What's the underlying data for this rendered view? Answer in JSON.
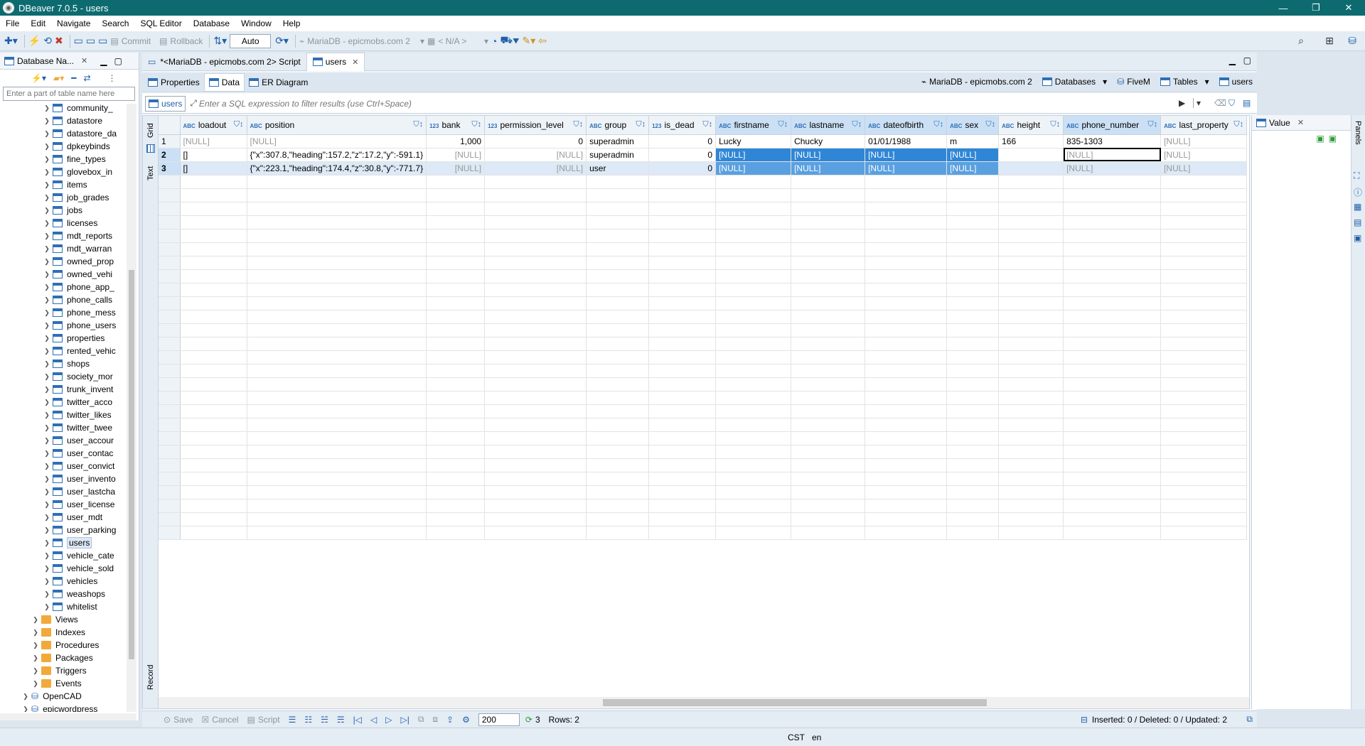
{
  "window": {
    "title": "DBeaver 7.0.5 - users"
  },
  "menu": [
    "File",
    "Edit",
    "Navigate",
    "Search",
    "SQL Editor",
    "Database",
    "Window",
    "Help"
  ],
  "toolbar": {
    "commit": "Commit",
    "rollback": "Rollback",
    "mode": "Auto",
    "connection": "MariaDB - epicmobs.com 2",
    "schema": "< N/A >"
  },
  "navigator": {
    "tab_label": "Database Na...",
    "filter_placeholder": "Enter a part of table name here",
    "tables": [
      "community_",
      "datastore",
      "datastore_da",
      "dpkeybinds",
      "fine_types",
      "glovebox_in",
      "items",
      "job_grades",
      "jobs",
      "licenses",
      "mdt_reports",
      "mdt_warran",
      "owned_prop",
      "owned_vehi",
      "phone_app_",
      "phone_calls",
      "phone_mess",
      "phone_users",
      "properties",
      "rented_vehic",
      "shops",
      "society_mor",
      "trunk_invent",
      "twitter_acco",
      "twitter_likes",
      "twitter_twee",
      "user_accour",
      "user_contac",
      "user_convict",
      "user_invento",
      "user_lastcha",
      "user_license",
      "user_mdt",
      "user_parking",
      "users",
      "vehicle_cate",
      "vehicle_sold",
      "vehicles",
      "weashops",
      "whitelist"
    ],
    "selected_table": "users",
    "folders": [
      "Views",
      "Indexes",
      "Procedures",
      "Packages",
      "Triggers",
      "Events"
    ],
    "databases": [
      "OpenCAD",
      "epicwordpress"
    ]
  },
  "editor": {
    "tabs": [
      "*<MariaDB - epicmobs.com 2> Script",
      "users"
    ],
    "subtabs": [
      "Properties",
      "Data",
      "ER Diagram"
    ],
    "breadcrumb": [
      "MariaDB - epicmobs.com 2",
      "Databases",
      "FiveM",
      "Tables",
      "users"
    ],
    "filter_table": "users",
    "filter_placeholder": "Enter a SQL expression to filter results (use Ctrl+Space)"
  },
  "grid": {
    "view_tabs": [
      "Grid",
      "Text",
      "Record"
    ],
    "columns": [
      {
        "name": "loadout",
        "type": "ABC"
      },
      {
        "name": "position",
        "type": "ABC"
      },
      {
        "name": "bank",
        "type": "123"
      },
      {
        "name": "permission_level",
        "type": "123"
      },
      {
        "name": "group",
        "type": "ABC"
      },
      {
        "name": "is_dead",
        "type": "123"
      },
      {
        "name": "firstname",
        "type": "ABC"
      },
      {
        "name": "lastname",
        "type": "ABC"
      },
      {
        "name": "dateofbirth",
        "type": "ABC"
      },
      {
        "name": "sex",
        "type": "ABC"
      },
      {
        "name": "height",
        "type": "ABC"
      },
      {
        "name": "phone_number",
        "type": "ABC"
      },
      {
        "name": "last_property",
        "type": "ABC"
      }
    ],
    "rows": [
      [
        "1",
        "[NULL]",
        "[NULL]",
        "1,000",
        "0",
        "superadmin",
        "0",
        "Lucky",
        "Chucky",
        "01/01/1988",
        "m",
        "166",
        "835-1303",
        "[NULL]"
      ],
      [
        "2",
        "[]",
        "{\"x\":307.8,\"heading\":157.2,\"z\":17.2,\"y\":-591.1}",
        "[NULL]",
        "[NULL]",
        "superadmin",
        "0",
        "[NULL]",
        "[NULL]",
        "[NULL]",
        "[NULL]",
        "",
        "[NULL]",
        "[NULL]"
      ],
      [
        "3",
        "[]",
        "{\"x\":223.1,\"heading\":174.4,\"z\":30.8,\"y\":-771.7}",
        "[NULL]",
        "[NULL]",
        "user",
        "0",
        "[NULL]",
        "[NULL]",
        "[NULL]",
        "[NULL]",
        "",
        "[NULL]",
        "[NULL]"
      ]
    ]
  },
  "value_panel": {
    "title": "Value"
  },
  "side_panel": {
    "label": "Panels"
  },
  "bottom": {
    "save": "Save",
    "cancel": "Cancel",
    "script": "Script",
    "fetch_size": "200",
    "fetch_count": "3",
    "rows_label": "Rows: 2",
    "summary": "Inserted: 0 / Deleted: 0 / Updated: 2"
  },
  "status": {
    "timezone": "CST",
    "locale": "en"
  }
}
